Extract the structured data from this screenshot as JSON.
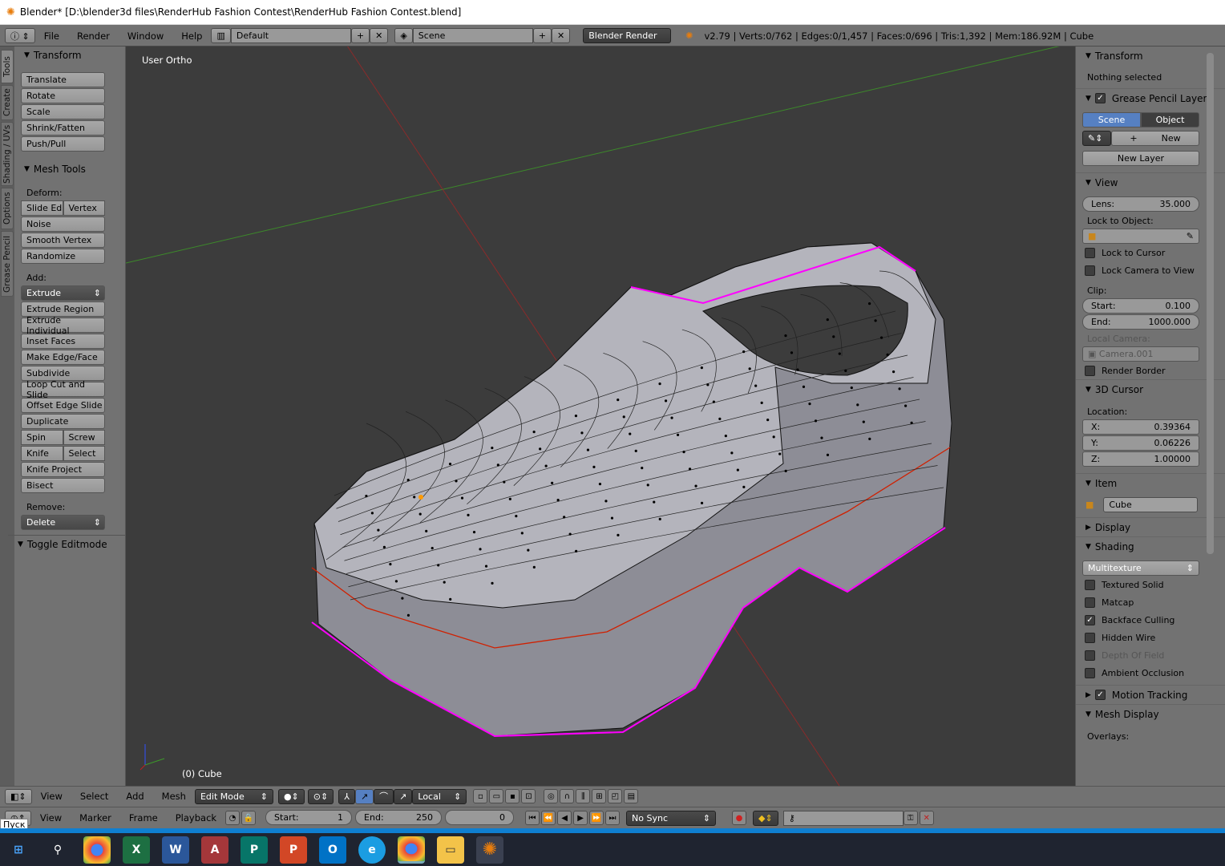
{
  "title": "Blender* [D:\\blender3d files\\RenderHub Fashion Contest\\RenderHub Fashion Contest.blend]",
  "topbar": {
    "menus": [
      "File",
      "Render",
      "Window",
      "Help"
    ],
    "layout": "Default",
    "scene": "Scene",
    "engine": "Blender Render",
    "stats": "v2.79 | Verts:0/762 | Edges:0/1,457 | Faces:0/696 | Tris:1,392 | Mem:186.92M | Cube"
  },
  "tabs": [
    "Tools",
    "Create",
    "Shading / UVs",
    "Options",
    "Grease Pencil"
  ],
  "toolshelf": {
    "transform_title": "Transform",
    "transform": [
      "Translate",
      "Rotate",
      "Scale",
      "Shrink/Fatten",
      "Push/Pull"
    ],
    "mesh_tools_title": "Mesh Tools",
    "deform_label": "Deform:",
    "slide_edge": "Slide Ed",
    "vertex": "Vertex",
    "deform": [
      "Noise",
      "Smooth Vertex",
      "Randomize"
    ],
    "add_label": "Add:",
    "extrude": "Extrude",
    "add": [
      "Extrude Region",
      "Extrude Individual",
      "Inset Faces",
      "Make Edge/Face",
      "Subdivide",
      "Loop Cut and Slide",
      "Offset Edge Slide",
      "Duplicate"
    ],
    "spin": "Spin",
    "screw": "Screw",
    "knife": "Knife",
    "select": "Select",
    "knife_project": "Knife Project",
    "bisect": "Bisect",
    "remove_label": "Remove:",
    "delete": "Delete",
    "toggle": "Toggle Editmode"
  },
  "viewport": {
    "view_name": "User Ortho",
    "object_label": "(0) Cube"
  },
  "rpanel": {
    "transform": "Transform",
    "nothing": "Nothing selected",
    "gp_layers": "Grease Pencil Layers",
    "scene_tab": "Scene",
    "object_tab": "Object",
    "new": "New",
    "new_layer": "New Layer",
    "view": "View",
    "lens_label": "Lens:",
    "lens": "35.000",
    "lock_obj": "Lock to Object:",
    "lock_cursor": "Lock to Cursor",
    "lock_camera": "Lock Camera to View",
    "clip": "Clip:",
    "start_label": "Start:",
    "start": "0.100",
    "end_label": "End:",
    "end": "1000.000",
    "local_camera": "Local Camera:",
    "camera": "Camera.001",
    "render_border": "Render Border",
    "cursor": "3D Cursor",
    "location": "Location:",
    "x_label": "X:",
    "x": "0.39364",
    "y_label": "Y:",
    "y": "0.06226",
    "z_label": "Z:",
    "z": "1.00000",
    "item": "Item",
    "item_name": "Cube",
    "display": "Display",
    "shading": "Shading",
    "shading_mode": "Multitexture",
    "shading_opts": [
      {
        "label": "Textured Solid",
        "checked": false
      },
      {
        "label": "Matcap",
        "checked": false
      },
      {
        "label": "Backface Culling",
        "checked": true
      },
      {
        "label": "Hidden Wire",
        "checked": false
      },
      {
        "label": "Depth Of Field",
        "checked": false
      },
      {
        "label": "Ambient Occlusion",
        "checked": false
      }
    ],
    "motion_tracking": "Motion Tracking",
    "mesh_display": "Mesh Display",
    "overlays": "Overlays:"
  },
  "vhead": {
    "menus": [
      "View",
      "Select",
      "Add",
      "Mesh"
    ],
    "mode": "Edit Mode",
    "orientation": "Local"
  },
  "timeline": {
    "menus": [
      "View",
      "Marker",
      "Frame",
      "Playback"
    ],
    "start_label": "Start:",
    "start": "1",
    "end_label": "End:",
    "end": "250",
    "current": "0",
    "sync": "No Sync"
  },
  "taskbar": {
    "start_tooltip": "Пуск"
  },
  "colors": {
    "selected_blue": "#5680c2",
    "edge_magenta": "#ff00ff",
    "seam_red": "#d02000"
  }
}
